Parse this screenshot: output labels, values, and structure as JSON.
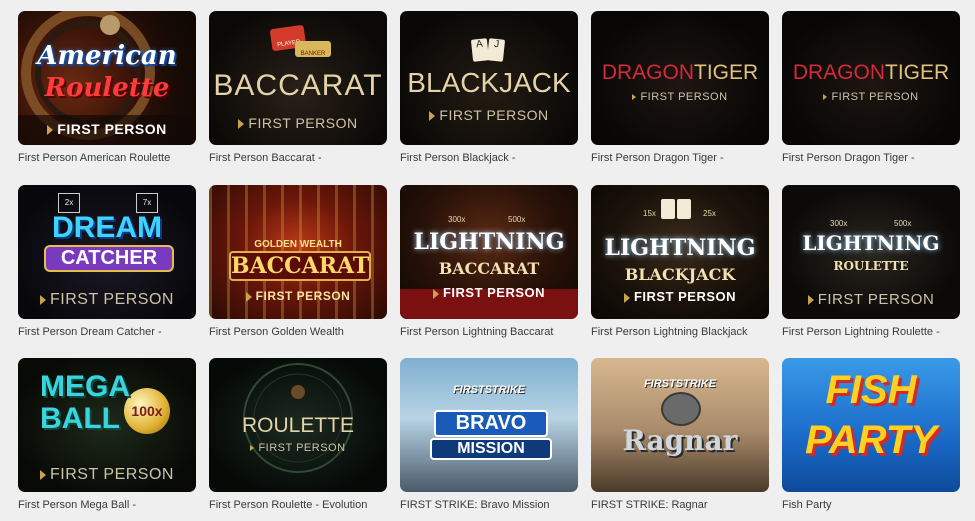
{
  "games": [
    {
      "title": "First Person American Roulette",
      "art": [
        "American",
        "Roulette",
        "FIRST PERSON"
      ]
    },
    {
      "title": "First Person Baccarat -",
      "art": [
        "BACCARAT",
        "FIRST PERSON",
        "PLAYER",
        "BANKER"
      ]
    },
    {
      "title": "First Person Blackjack -",
      "art": [
        "BLACKJACK",
        "FIRST PERSON"
      ]
    },
    {
      "title": "First Person Dragon Tiger -",
      "art": [
        "DRAGON",
        "TIGER",
        "FIRST PERSON"
      ]
    },
    {
      "title": "First Person Dragon Tiger -",
      "art": [
        "DRAGON",
        "TIGER",
        "FIRST PERSON"
      ]
    },
    {
      "title": "First Person Dream Catcher -",
      "art": [
        "DREAM",
        "CATCHER",
        "FIRST PERSON",
        "2x",
        "7x"
      ]
    },
    {
      "title": "First Person Golden Wealth",
      "art": [
        "GOLDEN WEALTH",
        "BACCARAT",
        "FIRST PERSON"
      ]
    },
    {
      "title": "First Person Lightning Baccarat",
      "art": [
        "LIGHTNING",
        "BACCARAT",
        "FIRST PERSON",
        "300x",
        "500x"
      ]
    },
    {
      "title": "First Person Lightning Blackjack",
      "art": [
        "LIGHTNING",
        "BLACKJACK",
        "FIRST PERSON",
        "15x",
        "25x"
      ]
    },
    {
      "title": "First Person Lightning Roulette -",
      "art": [
        "LIGHTNING",
        "ROULETTE",
        "FIRST PERSON",
        "300x",
        "500x"
      ]
    },
    {
      "title": "First Person Mega Ball -",
      "art": [
        "MEGA",
        "BALL",
        "100x",
        "FIRST PERSON"
      ]
    },
    {
      "title": "First Person Roulette - Evolution",
      "art": [
        "ROULETTE",
        "FIRST PERSON"
      ]
    },
    {
      "title": "FIRST STRIKE: Bravo Mission",
      "art": [
        "FIRSTSTRIKE",
        "BRAVO",
        "MISSION"
      ]
    },
    {
      "title": "FIRST STRIKE: Ragnar",
      "art": [
        "FIRSTSTRIKE",
        "Ragnar"
      ]
    },
    {
      "title": "Fish Party",
      "art": [
        "FISH",
        "PARTY"
      ]
    }
  ],
  "colors": {
    "background": "#efefef",
    "title_text": "#3a3a3a",
    "gold": "#d8b35a"
  }
}
